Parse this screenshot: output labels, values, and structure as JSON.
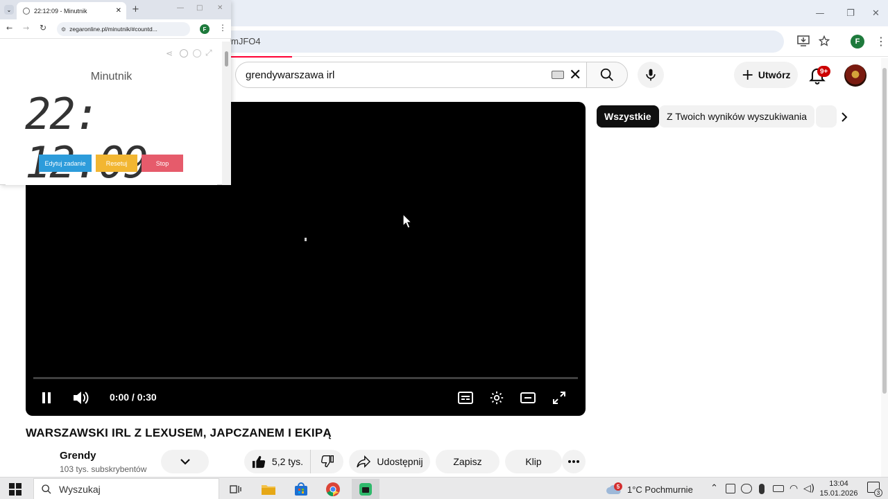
{
  "main_window": {
    "url_fragment": "mJFO4",
    "controls": {
      "minimize": "—",
      "restore": "❐",
      "close": "✕"
    },
    "profile_letter": "F"
  },
  "youtube": {
    "search_value": "grendywarszawa irl",
    "create_label": "Utwórz",
    "notifications_badge": "9+",
    "chips": [
      "Wszystkie",
      "Z Twoich wyników wyszukiwania"
    ],
    "player": {
      "time": "0:00 / 0:30"
    },
    "video_title": "WARSZAWSKI IRL Z LEXUSEM, JAPCZANEM I EKIPĄ",
    "channel": {
      "name": "Grendy",
      "subscribers": "103 tys. subskrybentów"
    },
    "actions": {
      "likes": "5,2 tys.",
      "share": "Udostępnij",
      "save": "Zapisz",
      "clip": "Klip"
    }
  },
  "mini_window": {
    "tab_title": "22:12:09 - Minutnik",
    "url": "zegaronline.pl/minutnik/#countd...",
    "profile_letter": "F",
    "app_title": "Minutnik",
    "clock": "22: 12:09",
    "buttons": {
      "edit": "Edytuj zadanie",
      "reset": "Resetuj",
      "stop": "Stop"
    },
    "colors": {
      "edit": "#2d9cdb",
      "reset": "#f2b632",
      "stop": "#e65b6b"
    }
  },
  "taskbar": {
    "search_placeholder": "Wyszukaj",
    "weather_badge": "5",
    "weather": "1°C  Pochmurnie",
    "time": "13:04",
    "date": "15.01.2026",
    "notification_count": "3"
  }
}
